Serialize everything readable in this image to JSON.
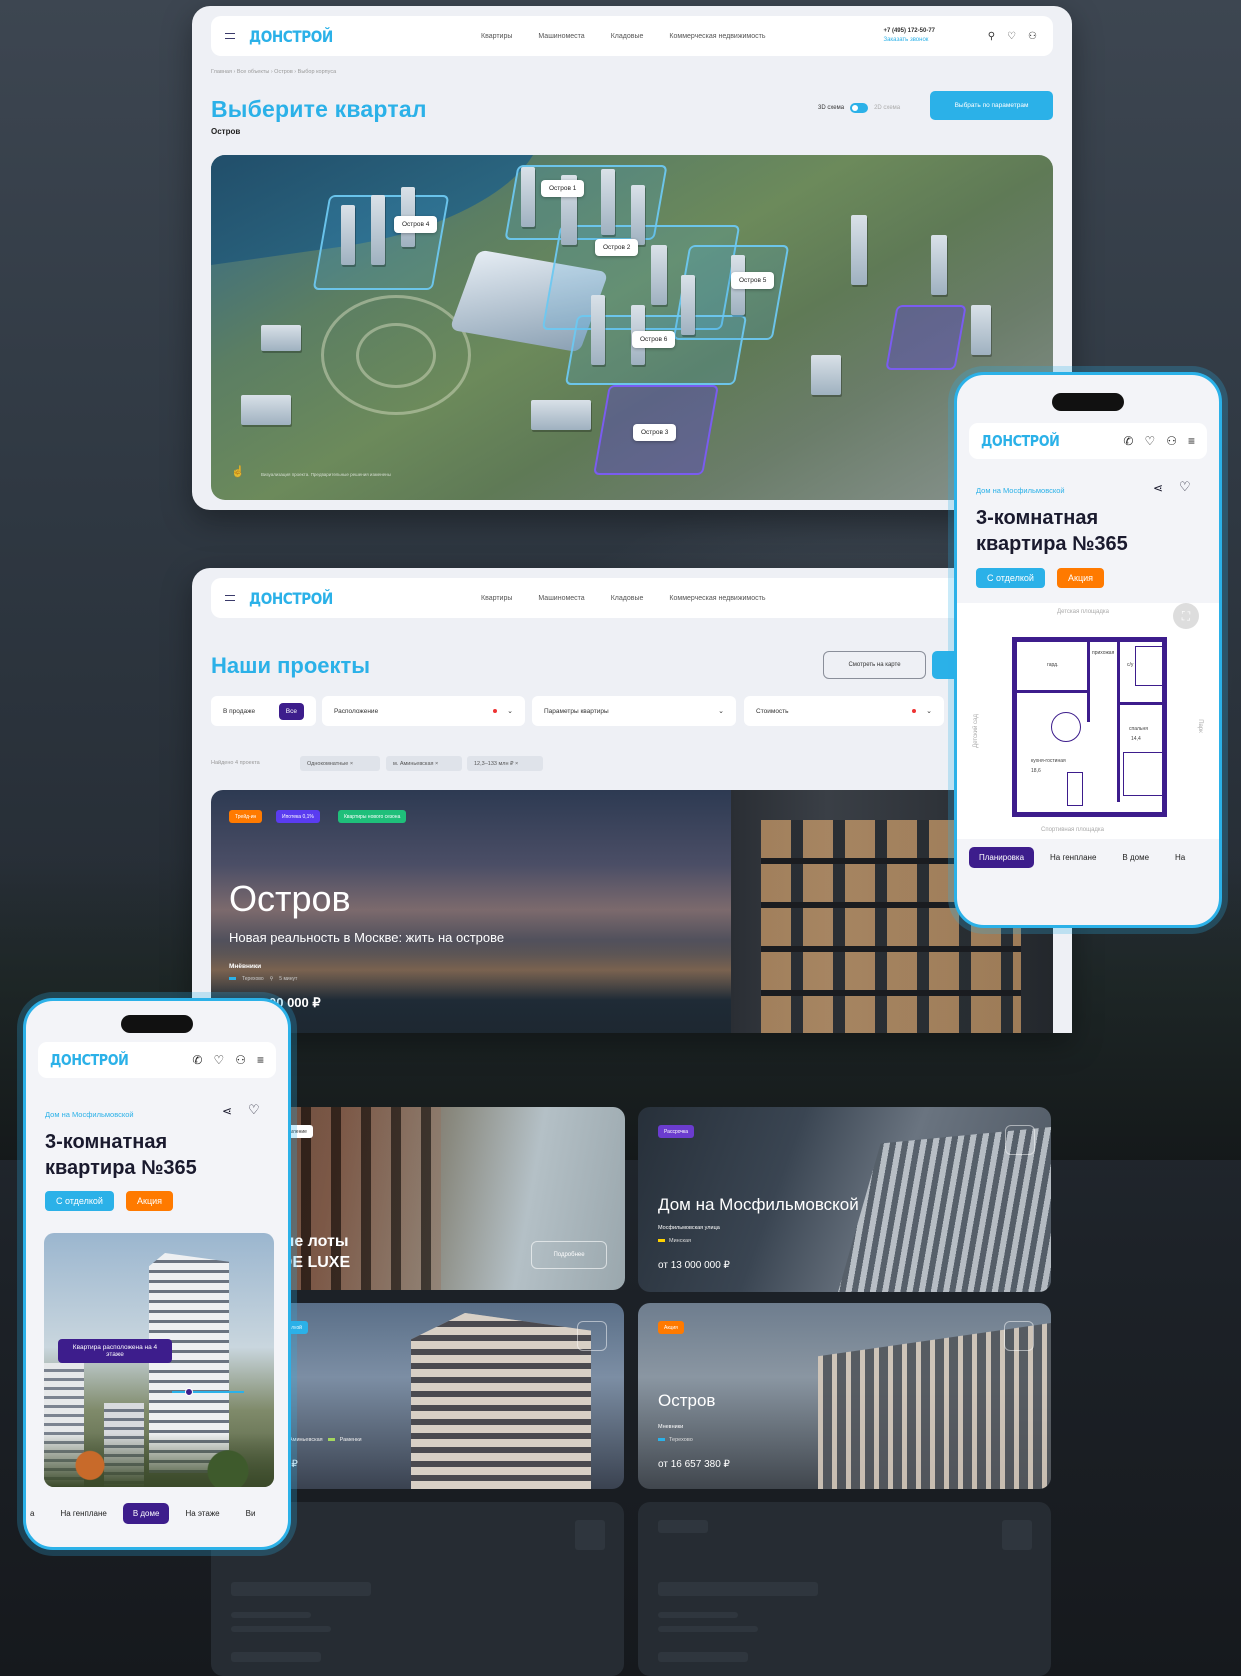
{
  "brand": {
    "logo": "ДОНСТРОЙ",
    "accent": "#2bb1e8",
    "purple": "#3d1d8c",
    "orange": "#ff7a00"
  },
  "nav": {
    "links": [
      "Квартиры",
      "Машиноместа",
      "Кладовые",
      "Коммерческая недвижимость"
    ],
    "phone": "+7 (495) 172-50-77",
    "callback": "Заказать звонок",
    "icons": [
      "search-icon",
      "heart-icon",
      "user-icon"
    ]
  },
  "quarter_page": {
    "breadcrumbs": "Главная › Все объекты › Остров › Выбор корпуса",
    "title": "Выберите квартал",
    "subtitle": "Остров",
    "toggle_3d": "3D схема",
    "toggle_2d": "2D схема",
    "params_button": "Выбрать по параметрам",
    "pins": [
      "Остров 1",
      "Остров 4",
      "Остров 2",
      "Остров 5",
      "Остров 6",
      "Остров 3"
    ],
    "map_note": "Визуализация проекта. Предварительные решения изменены"
  },
  "projects_page": {
    "title": "Наши проекты",
    "map_button": "Смотреть на карте",
    "seg_sale": "В продаже",
    "seg_all": "Все",
    "filters": [
      "Расположение",
      "Параметры квартиры",
      "Стоимость"
    ],
    "found": "Найдено 4 проекта",
    "chips": [
      "Однокомнатные ×",
      "м. Аминьевская ×",
      "12,3–133 млн ₽ ×"
    ],
    "hero": {
      "tags": [
        "Трейд-ин",
        "Ипотека 0,1%",
        "Квартиры нового сезона"
      ],
      "title": "Остров",
      "subtitle": "Новая реальность в Москве: жить на острове",
      "district": "Мнёвники",
      "metro": "Терехово",
      "walk": "5 минут",
      "price": "00 000 ₽"
    },
    "cards": [
      {
        "badge": "Рассрочка",
        "title": "Дом на Мосфильмовской",
        "address": "Мосфильмовская улица",
        "metro": "Минская",
        "price": "от 13 000 000 ₽"
      },
      {
        "badge": "Акция",
        "title": "Остров",
        "address": "Мневники",
        "metro": "Терехово",
        "price": "от 16 657 380 ₽"
      },
      {
        "badge": "оформление",
        "title": "ные лоты\n: DE LUXE",
        "button": "Подробнее"
      },
      {
        "badge": "с отделкой",
        "title": "а",
        "metro_a": "Аминьевская",
        "metro_b": "Раменки",
        "price": "0 ₽"
      }
    ]
  },
  "mobile_plan": {
    "project": "Дом на Мосфильмовской",
    "title_line1": "3-комнатная",
    "title_line2": "квартира №365",
    "badge_finish": "С отделкой",
    "badge_promo": "Акция",
    "label_top": "Детская площадка",
    "label_bottom": "Спортивная площадка",
    "label_left": "Детский сад",
    "label_right": "Парк",
    "rooms": [
      "прихожая",
      "гард.",
      "с/у",
      "спальня",
      "кухня-гостиная",
      "14,4",
      "18,6"
    ],
    "tabs": [
      "Планировка",
      "На генплане",
      "В доме",
      "На"
    ]
  },
  "mobile_house": {
    "project": "Дом на Мосфильмовской",
    "title_line1": "3-комнатная",
    "title_line2": "квартира №365",
    "badge_finish": "С отделкой",
    "badge_promo": "Акция",
    "floor_tooltip": "Квартира расположена на 4 этаже",
    "tabs": [
      "а",
      "На генплане",
      "В доме",
      "На этаже",
      "Ви"
    ]
  }
}
